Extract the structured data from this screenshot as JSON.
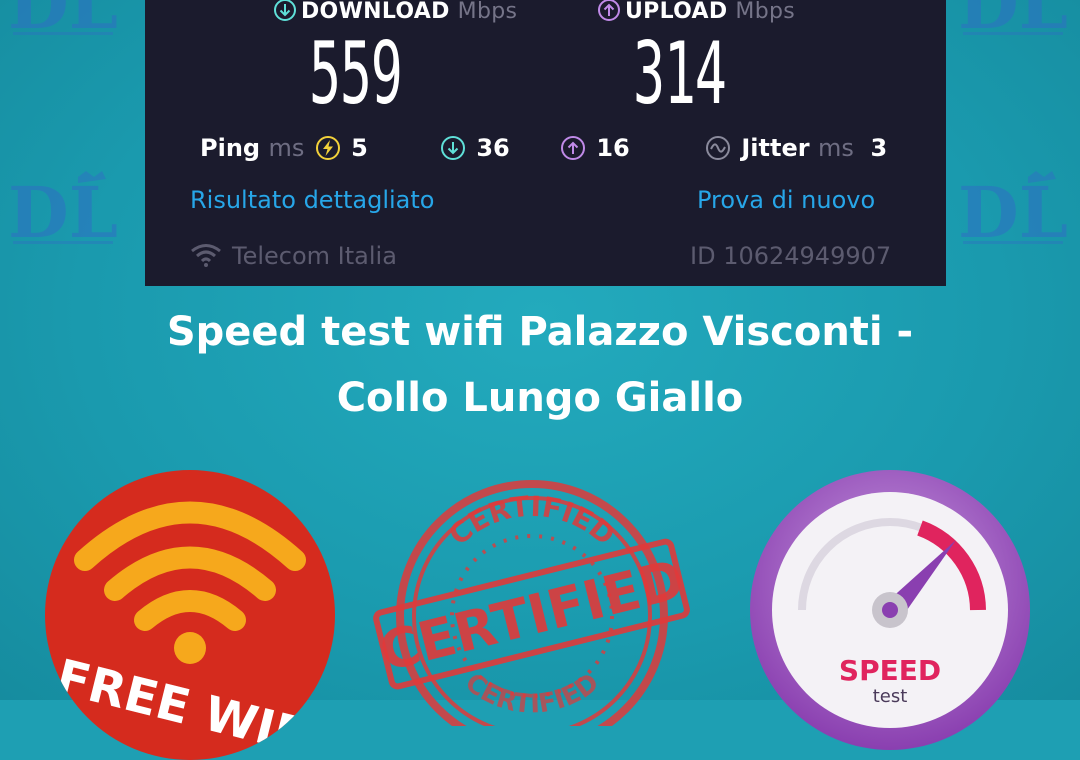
{
  "speedtest": {
    "download_label": "DOWNLOAD",
    "download_unit": "Mbps",
    "download_value": "559",
    "upload_label": "UPLOAD",
    "upload_unit": "Mbps",
    "upload_value": "314",
    "ping_label": "Ping",
    "ping_unit": "ms",
    "ping_value": "5",
    "download_latency": "36",
    "upload_latency": "16",
    "jitter_label": "Jitter",
    "jitter_unit": "ms",
    "jitter_value": "3",
    "detailed_result_link": "Risultato dettagliato",
    "retry_link": "Prova di nuovo",
    "provider": "Telecom Italia",
    "result_id": "ID 10624949907"
  },
  "caption": {
    "line1": "Speed test wifi Palazzo Visconti -",
    "line2": "Collo Lungo Giallo"
  },
  "badges": {
    "free_wifi": "FREE WIFI",
    "certified_main": "CERTIFIED",
    "certified_arc_top": "CERTIFIED",
    "certified_arc_bottom": "CERTIFIED",
    "speed_word": "SPEED",
    "speed_sub": "test"
  },
  "logo_letters": "DL",
  "colors": {
    "background": "#1e9fb3",
    "panel": "#1b1b2d",
    "download_icon": "#5fe0d8",
    "upload_icon": "#c08ae8",
    "ping_icon": "#f2d13a",
    "link": "#27a6e8",
    "wifi_badge": "#d52b1e",
    "wifi_signal": "#f6a81c",
    "certified_stamp": "#e03a3a",
    "speed_ring": "#9a4fc0"
  }
}
